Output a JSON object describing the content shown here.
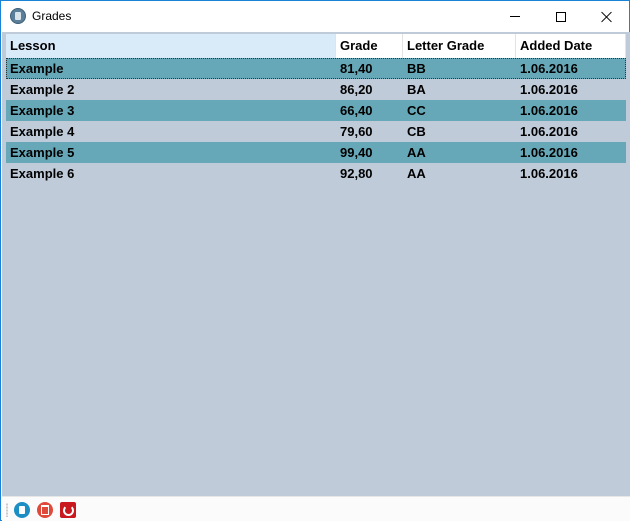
{
  "window": {
    "title": "Grades",
    "controls": {
      "minimize": "minimize-icon",
      "maximize": "maximize-icon",
      "close": "close-icon"
    }
  },
  "grid": {
    "columns": [
      "Lesson",
      "Grade",
      "Letter Grade",
      "Added Date"
    ],
    "rows": [
      {
        "lesson": "Example",
        "grade": "81,40",
        "letter": "BB",
        "date": "1.06.2016"
      },
      {
        "lesson": "Example 2",
        "grade": "86,20",
        "letter": "BA",
        "date": "1.06.2016"
      },
      {
        "lesson": "Example 3",
        "grade": "66,40",
        "letter": "CC",
        "date": "1.06.2016"
      },
      {
        "lesson": "Example 4",
        "grade": "79,60",
        "letter": "CB",
        "date": "1.06.2016"
      },
      {
        "lesson": "Example 5",
        "grade": "99,40",
        "letter": "AA",
        "date": "1.06.2016"
      },
      {
        "lesson": "Example 6",
        "grade": "92,80",
        "letter": "AA",
        "date": "1.06.2016"
      }
    ]
  },
  "toolbar": {
    "buttons": [
      "new-record-icon",
      "delete-icon",
      "exit-icon"
    ]
  },
  "colors": {
    "grid_background": "#bfcbd9",
    "alternate_row": "#66a8b8",
    "header_sorted": "#d9eaf8",
    "window_border": "#1883d7"
  }
}
